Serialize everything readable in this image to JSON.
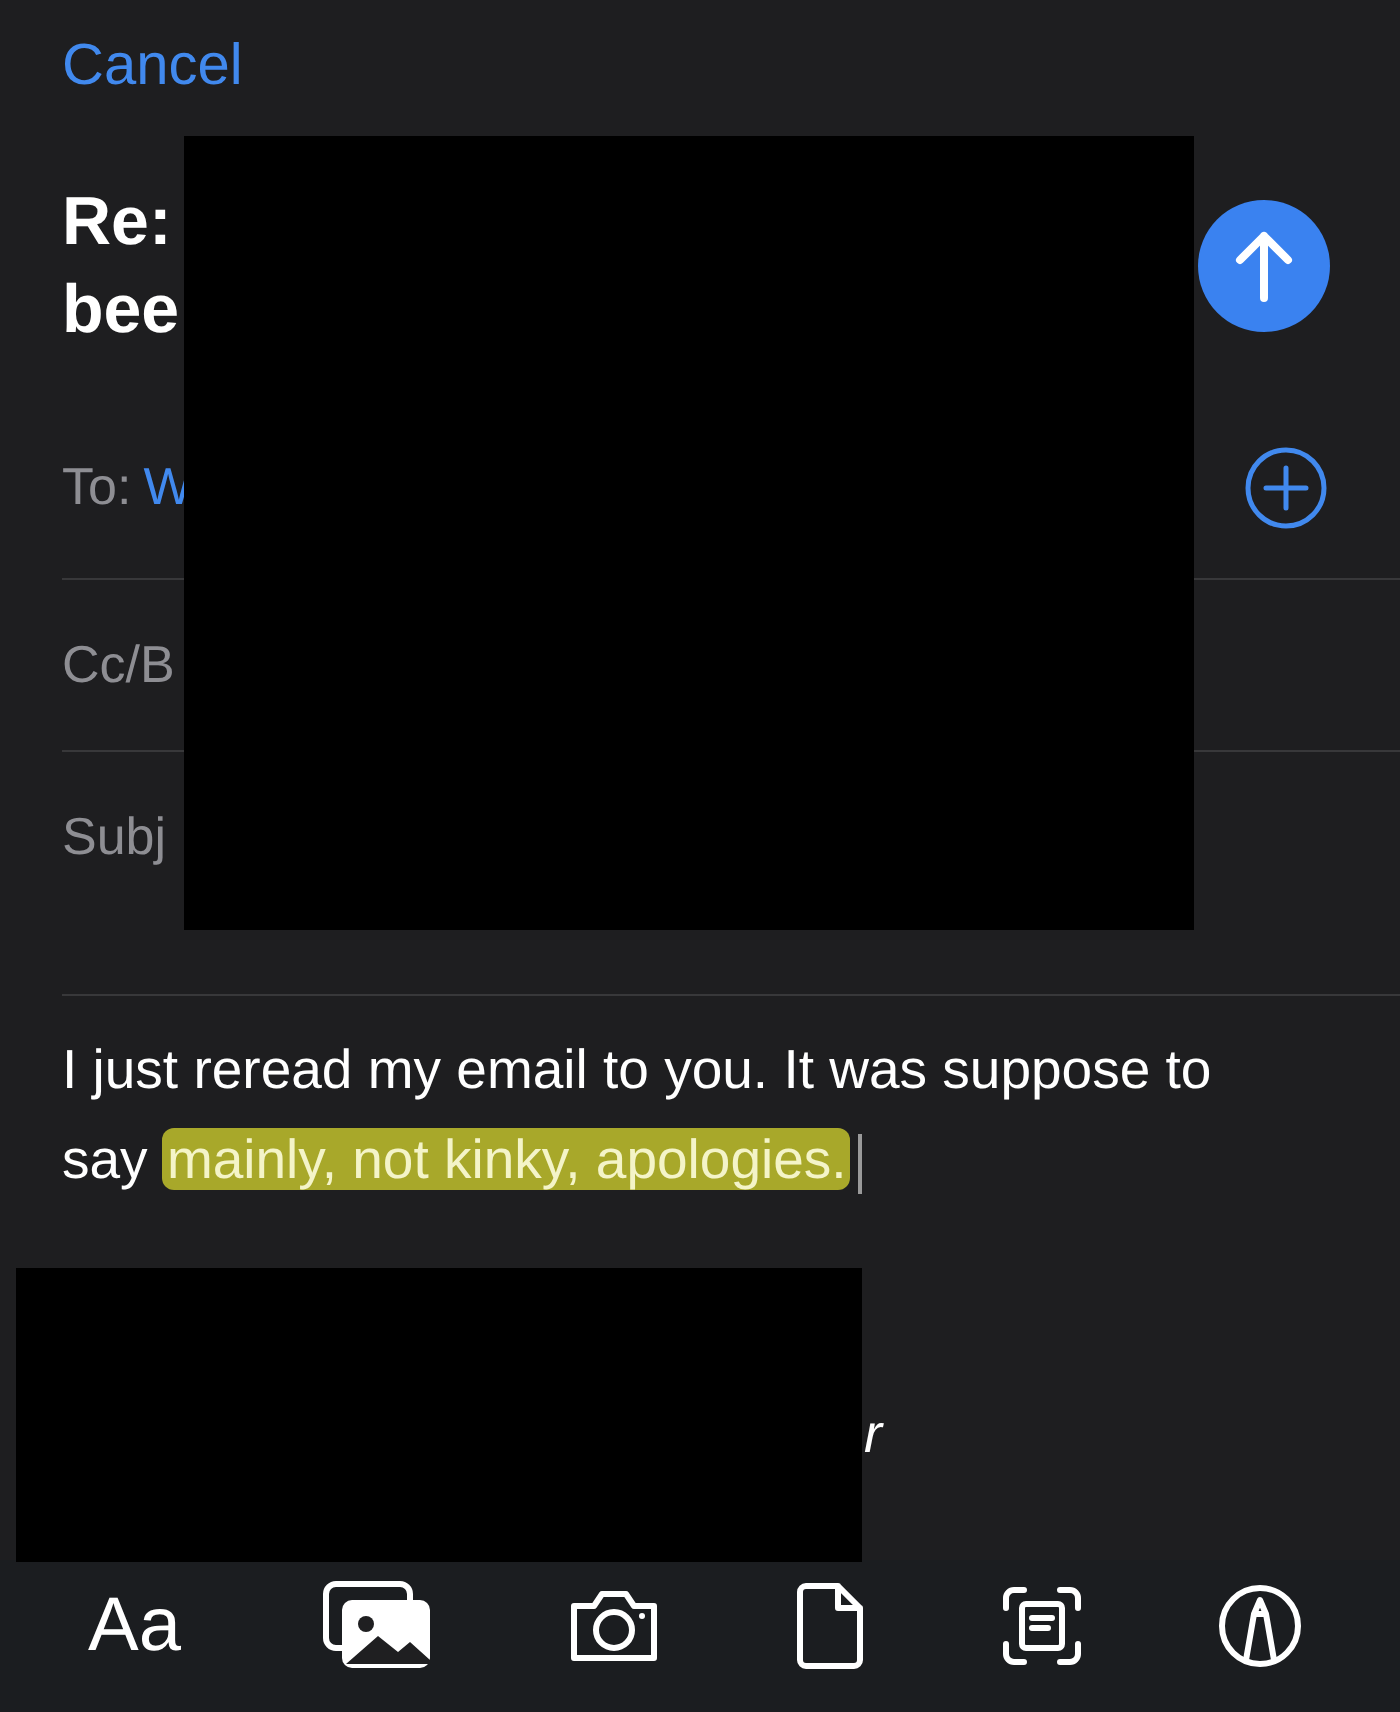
{
  "nav": {
    "cancel": "Cancel"
  },
  "subject_heading": {
    "lines": [
      "Re:",
      "bee"
    ],
    "redacted": true
  },
  "fields": [
    {
      "label": "To:",
      "value": "W",
      "kind": "recipients"
    },
    {
      "label": "Cc/B",
      "kind": "plain"
    },
    {
      "label": "Subj",
      "kind": "plain"
    }
  ],
  "body": {
    "segments": [
      {
        "text": "I just reread my email to you. It was suppose to say ",
        "highlighted": false
      },
      {
        "text": "mainly, not kinky, apologies.",
        "highlighted": true
      }
    ],
    "signature_fragment": "r",
    "signature_redacted": true
  },
  "toolbar": [
    {
      "kind": "text",
      "label": "Aa"
    },
    {
      "kind": "photos"
    },
    {
      "kind": "camera"
    },
    {
      "kind": "document"
    },
    {
      "kind": "scan"
    },
    {
      "kind": "markup"
    }
  ]
}
